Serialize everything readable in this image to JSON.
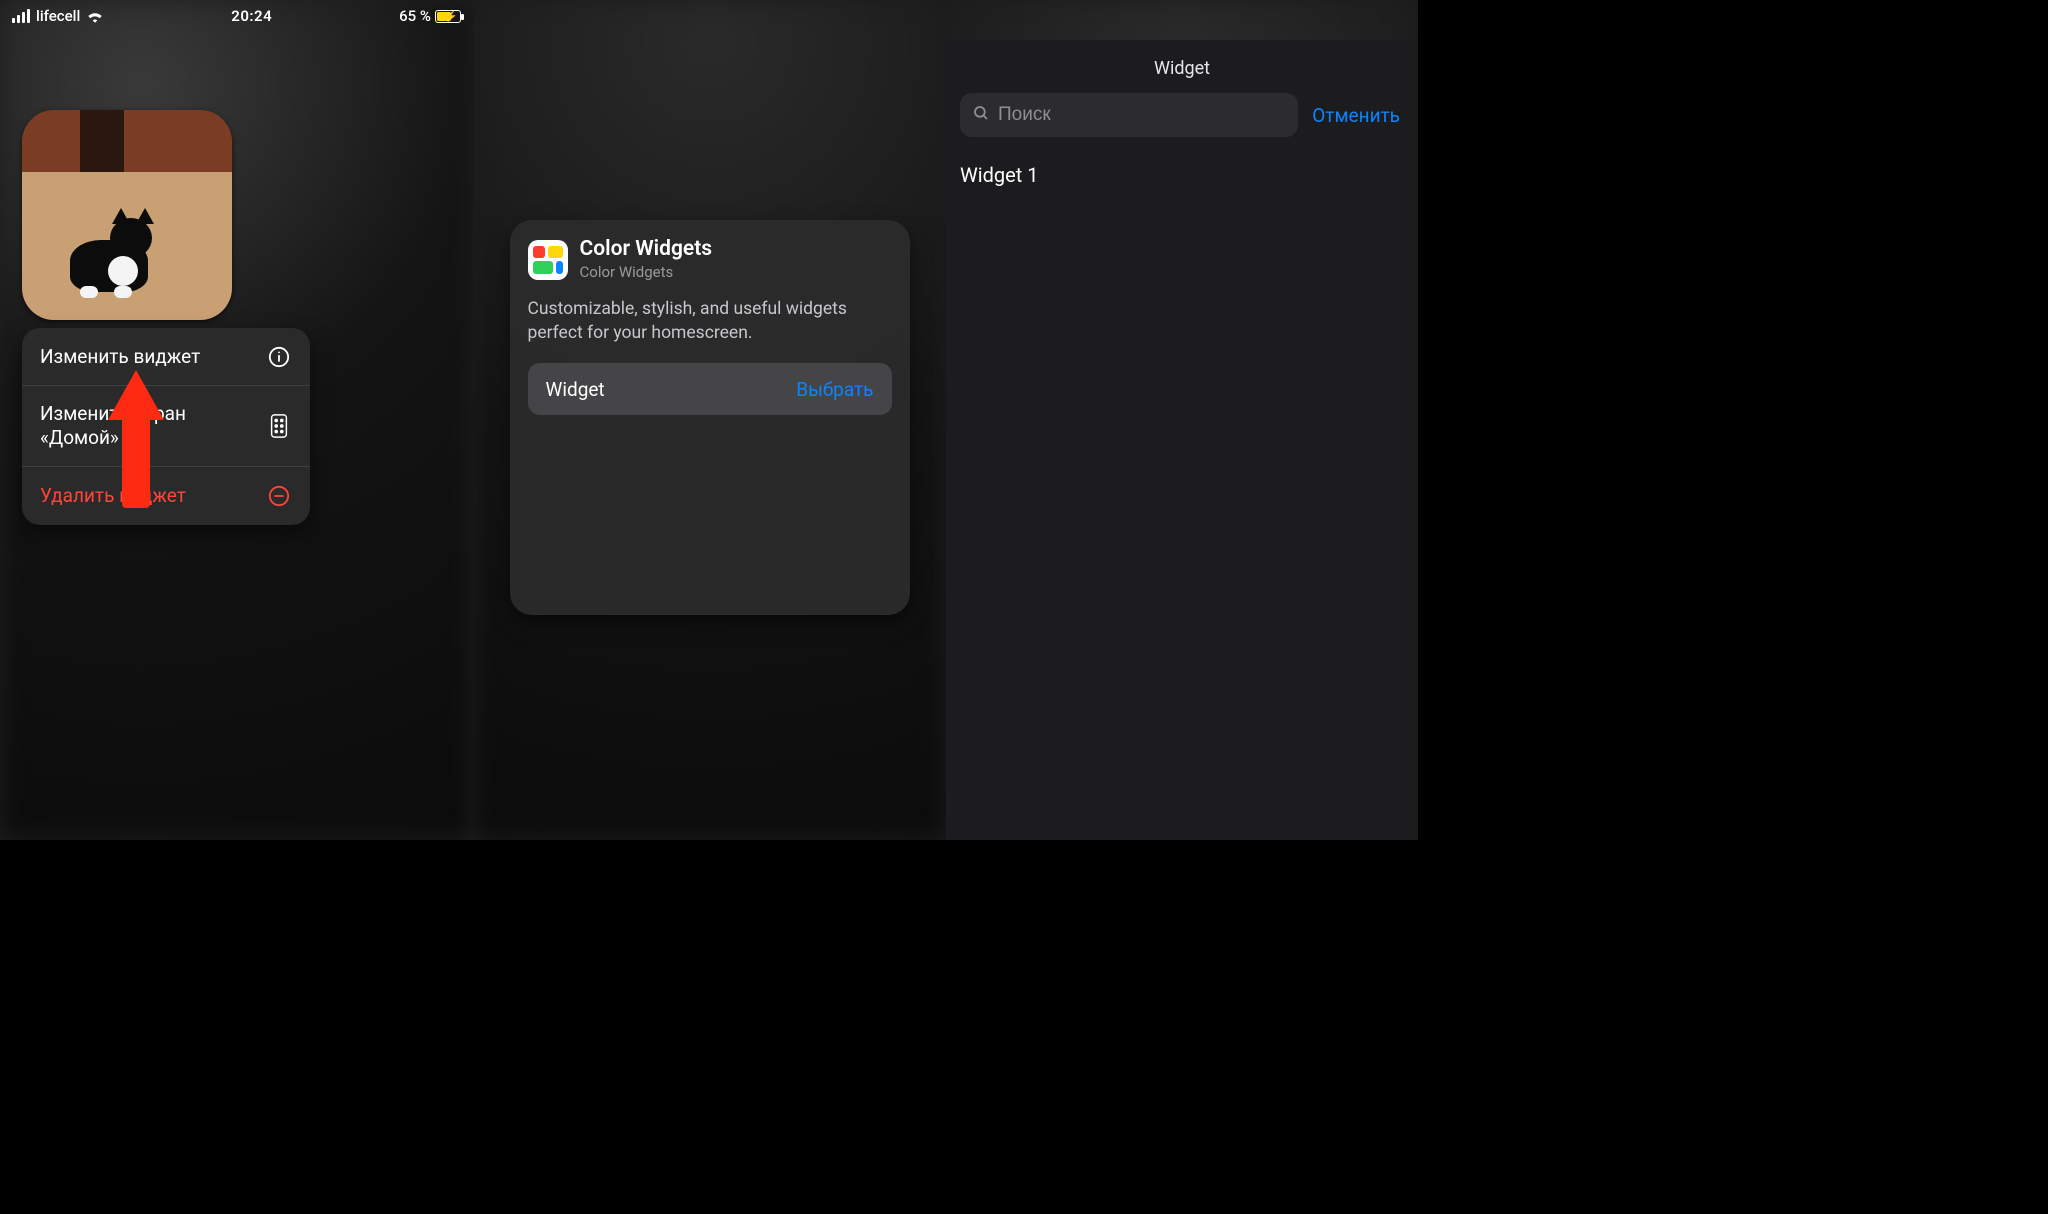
{
  "status_bar": {
    "carrier": "lifecell",
    "time": "20:24",
    "battery_text": "65 %"
  },
  "panel1": {
    "context_menu": {
      "edit_widget": "Изменить виджет",
      "edit_home": "Изменить экран «Домой»",
      "delete_widget": "Удалить виджет"
    }
  },
  "panel2": {
    "app_title": "Color Widgets",
    "app_subtitle": "Color Widgets",
    "description": "Customizable, stylish, and useful widgets perfect for your homescreen.",
    "row_label": "Widget",
    "row_action": "Выбрать"
  },
  "panel3": {
    "sheet_title": "Widget",
    "search_placeholder": "Поиск",
    "cancel": "Отменить",
    "results": [
      "Widget 1"
    ]
  }
}
